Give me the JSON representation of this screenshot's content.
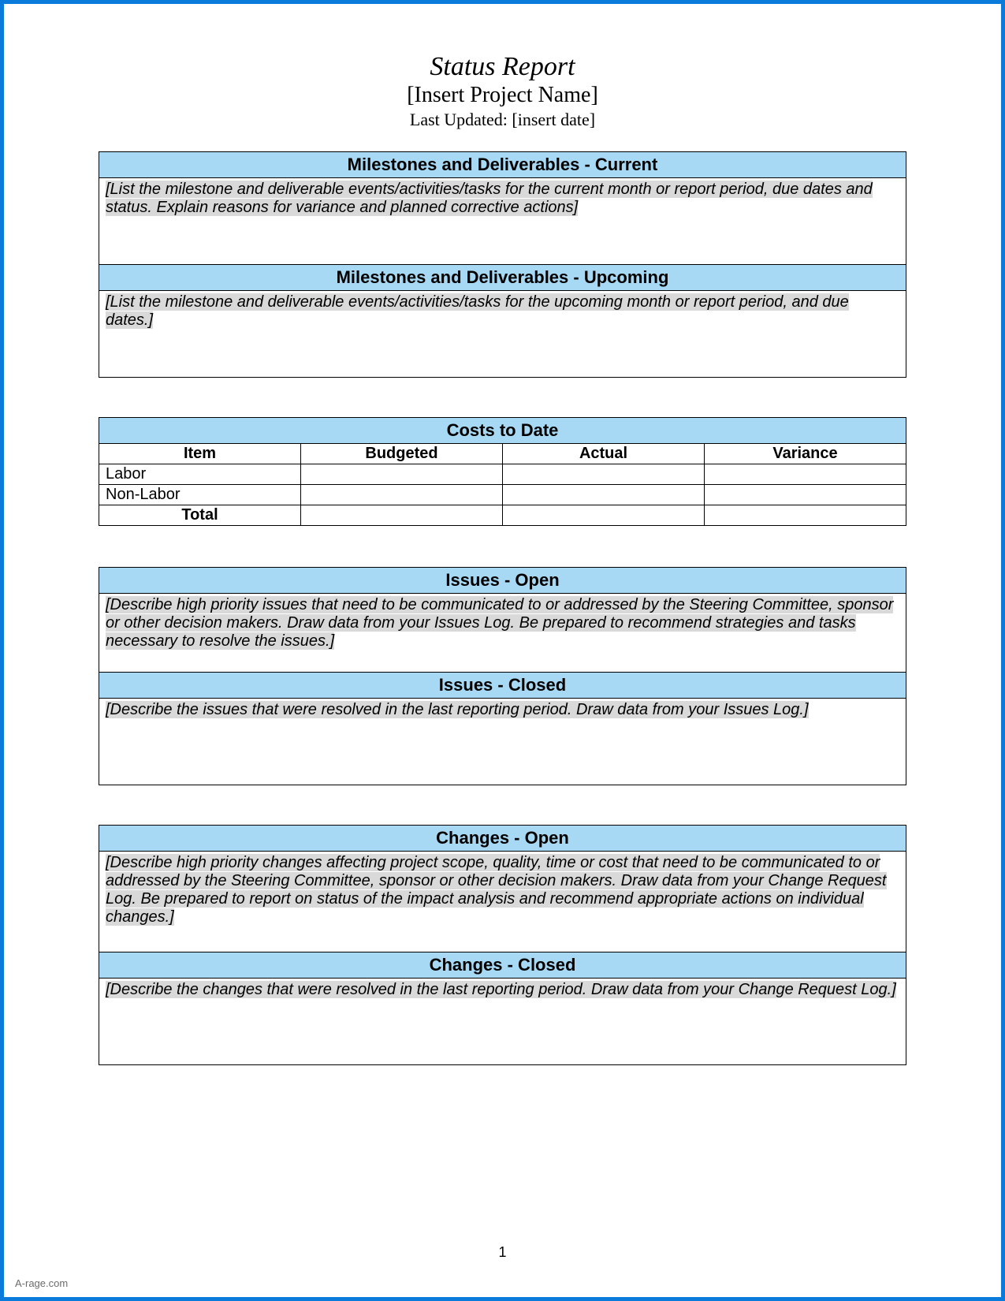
{
  "header": {
    "title": "Status Report",
    "project_name": "[Insert Project Name]",
    "last_updated_label": "Last Updated: [insert date]"
  },
  "milestones": {
    "current": {
      "header": "Milestones and Deliverables - Current",
      "body": "[List the milestone and deliverable events/activities/tasks for the current month or report period, due dates and status.  Explain reasons for variance and planned corrective actions]"
    },
    "upcoming": {
      "header": "Milestones and Deliverables - Upcoming",
      "body": "[List the milestone and deliverable events/activities/tasks for the upcoming month or report period, and due dates.]"
    }
  },
  "costs": {
    "title": "Costs to Date",
    "columns": [
      "Item",
      "Budgeted",
      "Actual",
      "Variance"
    ],
    "rows": [
      {
        "item": "Labor",
        "budgeted": "",
        "actual": "",
        "variance": ""
      },
      {
        "item": "Non-Labor",
        "budgeted": "",
        "actual": "",
        "variance": ""
      }
    ],
    "total_label": "Total"
  },
  "issues": {
    "open": {
      "header": "Issues - Open",
      "body": "[Describe high priority issues that need to be communicated to or addressed by the Steering Committee, sponsor or other decision makers.  Draw data from your Issues Log.  Be prepared to recommend strategies and tasks necessary to resolve the issues.]"
    },
    "closed": {
      "header": "Issues - Closed",
      "body": "[Describe the issues that were resolved in the last reporting period.  Draw data from your Issues Log.]"
    }
  },
  "changes": {
    "open": {
      "header": "Changes - Open",
      "body": "[Describe high priority changes affecting project scope, quality, time or cost that need to be communicated to or addressed by the Steering Committee, sponsor or other decision makers.  Draw data from your Change Request Log.  Be prepared to report on status of the impact analysis and recommend appropriate actions on individual changes.]"
    },
    "closed": {
      "header": "Changes - Closed",
      "body": "[Describe the changes that were resolved in the last reporting period.  Draw data from your Change Request Log.]"
    }
  },
  "page_number": "1",
  "watermark": "A-rage.com"
}
